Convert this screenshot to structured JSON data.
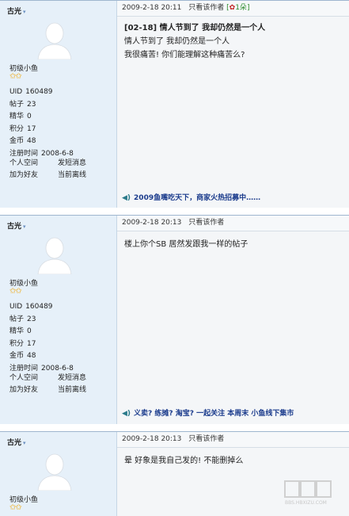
{
  "posts": [
    {
      "author": "古光",
      "rank": "初级小鱼",
      "stars": "✩✩",
      "stats": [
        {
          "k": "UID",
          "v": "160489"
        },
        {
          "k": "帖子",
          "v": "23"
        },
        {
          "k": "精华",
          "v": "0"
        },
        {
          "k": "积分",
          "v": "17"
        },
        {
          "k": "金币",
          "v": "48"
        },
        {
          "k": "注册时间",
          "v": "2008-6-8"
        }
      ],
      "actions": [
        "个人空间",
        "发短消息",
        "加为好友",
        "当前离线"
      ],
      "date": "2009-2-18 20:11",
      "only_author": "只看该作者",
      "flower": "1朵",
      "title": "[02-18] 情人节到了  我却仍然是一个人",
      "lines": [
        "情人节到了  我却仍然是一个人",
        "我很痛苦!  你们能理解这种痛苦么?"
      ],
      "sig": "2009鱼嘴吃天下，商家火热招募中……",
      "sig2": ""
    },
    {
      "author": "古光",
      "rank": "初级小鱼",
      "stars": "✩✩",
      "stats": [
        {
          "k": "UID",
          "v": "160489"
        },
        {
          "k": "帖子",
          "v": "23"
        },
        {
          "k": "精华",
          "v": "0"
        },
        {
          "k": "积分",
          "v": "17"
        },
        {
          "k": "金币",
          "v": "48"
        },
        {
          "k": "注册时间",
          "v": "2008-6-8"
        }
      ],
      "actions": [
        "个人空间",
        "发短消息",
        "加为好友",
        "当前离线"
      ],
      "date": "2009-2-18 20:13",
      "only_author": "只看该作者",
      "lines": [
        "楼上你个SB 居然发跟我一样的帖子"
      ],
      "sig": "义卖? 练摊? 淘宝? 一起关注  本周末  小鱼线下集市"
    },
    {
      "author": "古光",
      "rank": "初级小鱼",
      "stars": "✩✩",
      "date": "2009-2-18 20:13",
      "only_author": "只看该作者",
      "lines": [
        "晕  好象是我自己发的!   不能删掉么"
      ]
    }
  ],
  "watermark": "BBS.HBXIZU.COM"
}
